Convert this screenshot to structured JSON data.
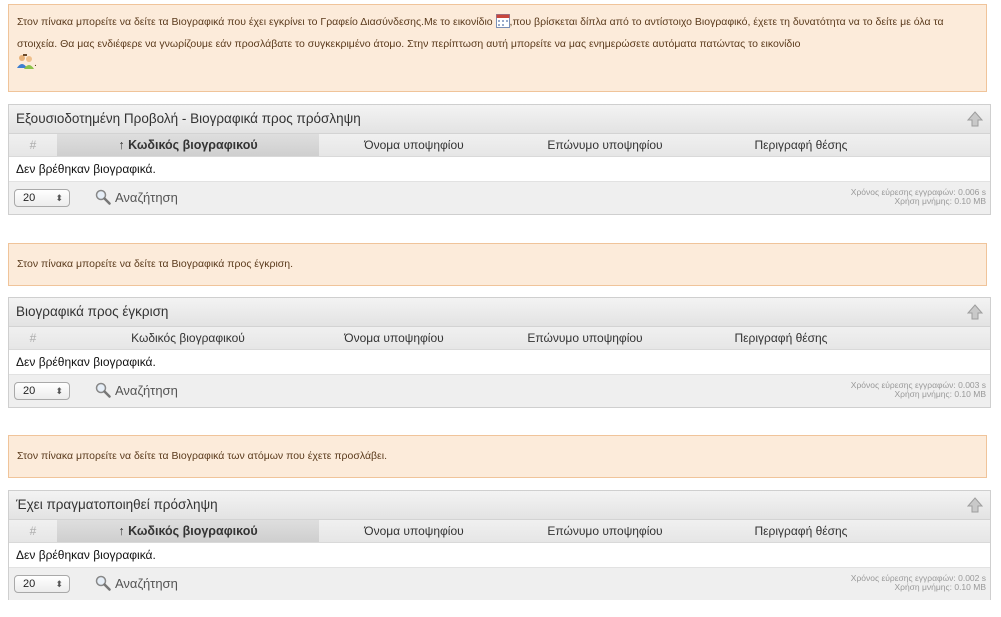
{
  "notices": {
    "approved_part1": "Στον πίνακα μπορείτε να δείτε τα Βιογραφικά που έχει εγκρίνει το Γραφείο Διασύνδεσης.Με το εικονίδιο",
    "approved_part2": ",που βρίσκεται δίπλα από το αντίστοιχο Βιογραφικό, έχετε τη δυνατότητα να το δείτε με όλα τα στοιχεία. Θα μας ενδιέφερε να γνωρίζουμε εάν προσλάβατε το συγκεκριμένο άτομο. Στην περίπτωση αυτή μπορείτε να μας ενημερώσετε αυτόματα πατώντας το εικονίδιο",
    "approved_part3": ".",
    "pending": "Στον πίνακα μπορείτε να δείτε τα Βιογραφικά προς έγκριση.",
    "hired": "Στον πίνακα μπορείτε να δείτε τα Βιογραφικά των ατόμων που έχετε προσλάβει."
  },
  "columns": {
    "hash": "#",
    "code": "Κωδικός βιογραφικού",
    "code_sorted": "↑ Κωδικός βιογραφικού",
    "first_name": "Όνομα υποψηφίου",
    "last_name": "Επώνυμο υποψηφίου",
    "position": "Περιγραφή θέσης"
  },
  "empty_text": "Δεν βρέθηκαν βιογραφικά.",
  "page_size": "20",
  "search_label": "Αναζήτηση",
  "panels": {
    "approved": {
      "title": "Εξουσιοδοτημένη Προβολή - Βιογραφικά προς πρόσληψη",
      "stats_time": "Χρόνος εύρεσης εγγραφών: 0.006 s",
      "stats_mem": "Χρήση μνήμης: 0.10 MB"
    },
    "pending": {
      "title": "Βιογραφικά προς έγκριση",
      "stats_time": "Χρόνος εύρεσης εγγραφών: 0.003 s",
      "stats_mem": "Χρήση μνήμης: 0.10 MB"
    },
    "hired": {
      "title": "Έχει πραγματοποιηθεί πρόσληψη",
      "stats_time": "Χρόνος εύρεσης εγγραφών: 0.002 s",
      "stats_mem": "Χρήση μνήμης: 0.10 MB"
    }
  },
  "colors": {
    "notice_bg": "#fcebda",
    "notice_border": "#f0c49a",
    "header_bg": "#e8e8e8",
    "footer_bg": "#efefef"
  },
  "icons": [
    "calendar-view-icon",
    "hire-people-icon",
    "collapse-arrow-icon",
    "magnifier-icon"
  ]
}
